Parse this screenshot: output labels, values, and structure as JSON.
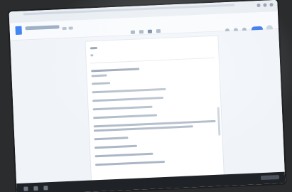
{
  "app": {
    "title": "",
    "share_label": ""
  },
  "colors": {
    "accent": "#3b78e7",
    "doc_icon": "#4285f4",
    "taskbar": "#1f2227"
  },
  "icons": {
    "doc": "docs-icon",
    "share": "share-button",
    "avatar": "account-avatar"
  }
}
